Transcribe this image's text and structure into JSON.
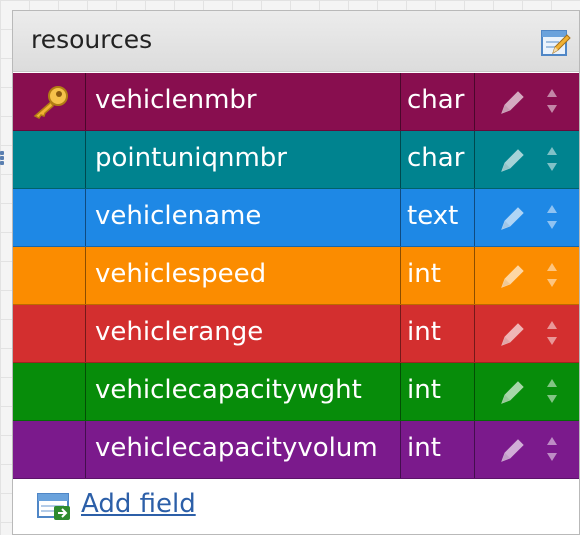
{
  "table": {
    "title": "resources",
    "fields": [
      {
        "name": "vehiclenmbr",
        "type": "char",
        "color": "#880e4f",
        "primary_key": true
      },
      {
        "name": "pointuniqnmbr",
        "type": "char",
        "color": "#00838f",
        "primary_key": false
      },
      {
        "name": "vehiclename",
        "type": "text",
        "color": "#1e88e5",
        "primary_key": false
      },
      {
        "name": "vehiclespeed",
        "type": "int",
        "color": "#fb8c00",
        "primary_key": false
      },
      {
        "name": "vehiclerange",
        "type": "int",
        "color": "#d32f2f",
        "primary_key": false
      },
      {
        "name": "vehiclecapacitywght",
        "type": "int",
        "color": "#078c0a",
        "primary_key": false
      },
      {
        "name": "vehiclecapacityvolum",
        "type": "int",
        "color": "#7b1a8c",
        "primary_key": false
      }
    ],
    "add_field_label": "Add field"
  },
  "icons": {
    "header_edit": "edit-table-icon",
    "primary_key": "key-icon",
    "row_edit": "pencil-icon",
    "row_sort": "sort-arrows-icon",
    "add_field": "add-field-icon"
  }
}
